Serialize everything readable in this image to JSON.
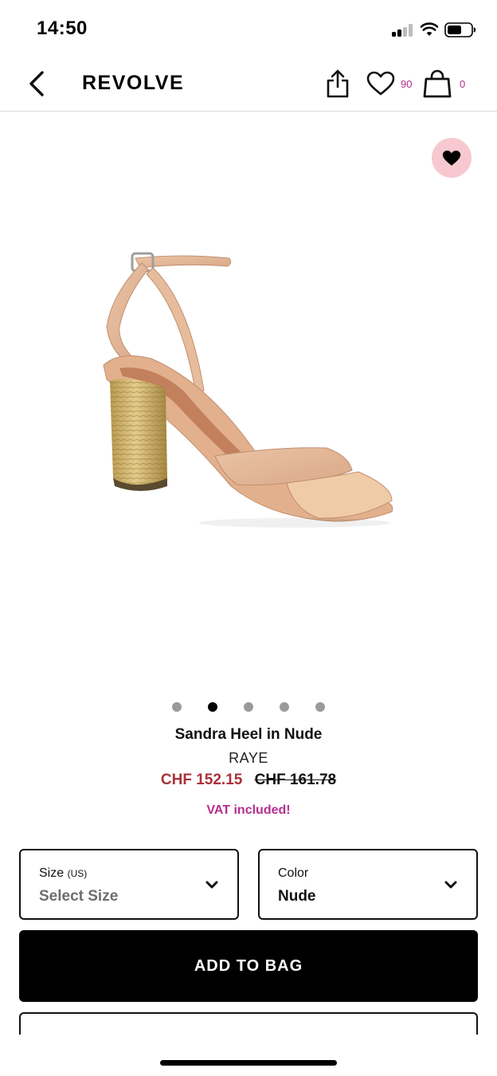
{
  "status_bar": {
    "time": "14:50"
  },
  "nav": {
    "brand": "REVOLVE",
    "wishlist_count": "90",
    "bag_count": "0"
  },
  "product": {
    "name": "Sandra Heel in Nude",
    "brand": "RAYE",
    "sale_price": "CHF 152.15",
    "original_price": "CHF 161.78",
    "vat_note": "VAT included!",
    "image_count": 5,
    "active_image_index": 1
  },
  "selectors": {
    "size_label": "Size",
    "size_unit": "(US)",
    "size_value": "Select Size",
    "color_label": "Color",
    "color_value": "Nude"
  },
  "actions": {
    "add_to_bag": "ADD TO BAG"
  },
  "colors": {
    "sale_price": "#a8323a",
    "accent": "#b3308f",
    "favorite_badge": "#f7c8cf"
  }
}
